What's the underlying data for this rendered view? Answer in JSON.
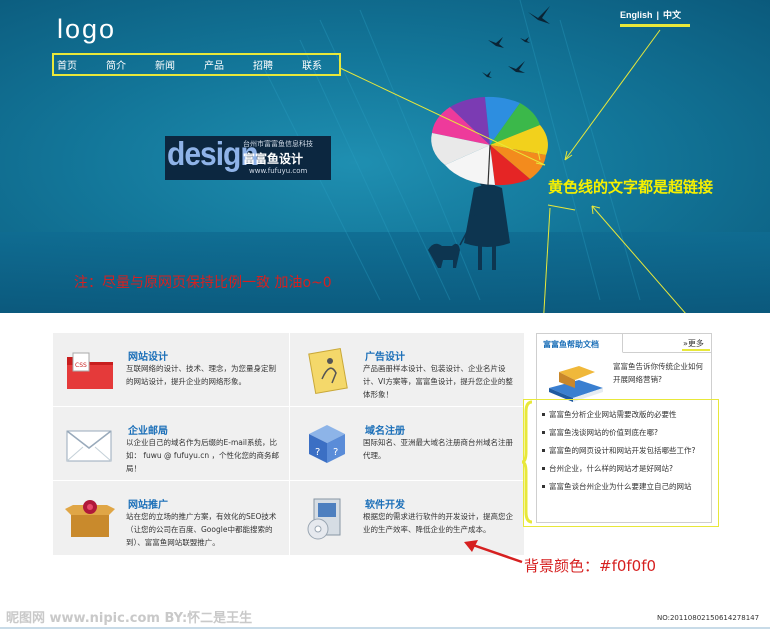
{
  "header": {
    "logo": "logo",
    "nav": [
      "首页",
      "简介",
      "新闻",
      "产品",
      "招聘",
      "联系"
    ],
    "lang_en": "English",
    "lang_sep": "|",
    "lang_cn": "中文"
  },
  "design_badge": {
    "word": "design",
    "company": "台州市富富鱼信息科技",
    "name": "富富鱼设计",
    "url": "www.fufuyu.com"
  },
  "annotations": {
    "hyperlink_note": "黄色线的文字都是超链接",
    "ratio_note": "注：尽量与原网页保持比例一致 加油o~0",
    "bg_note": "背景颜色：#f0f0f0"
  },
  "services": [
    {
      "title": "网站设计",
      "desc": "互联网络的设计、技术、理念，为您量身定制的网站设计，提升企业的网络形象。",
      "icon": "folder-css-icon"
    },
    {
      "title": "广告设计",
      "desc": "产品画册样本设计、包装设计、企业名片设计、VI方案等，富富鱼设计，提升您企业的整体形象！",
      "icon": "notepad-sketch-icon"
    },
    {
      "title": "企业邮局",
      "desc": "以企业自己的域名作为后缀的E-mail系统，比如： fuwu @ fufuyu.cn ，个性化您的商务邮局！",
      "icon": "envelope-icon"
    },
    {
      "title": "域名注册",
      "desc": "国际知名、亚洲最大域名注册商台州域名注册代理。",
      "icon": "cube-question-icon"
    },
    {
      "title": "网站推广",
      "desc": "站在您的立场的推广方案，有效化的SEO技术（让您的公司在百度、Google中都能搜索的到）、富富鱼网站联盟推广。",
      "icon": "gift-box-icon"
    },
    {
      "title": "软件开发",
      "desc": "根据您的需求进行软件的开发设计，提高您企业的生产效率、降低企业的生产成本。",
      "icon": "software-box-icon"
    }
  ],
  "help": {
    "tab": "富富鱼帮助文档",
    "more": "更多",
    "intro": "富富鱼告诉你传统企业如何开展网络营销?",
    "items": [
      "富富鱼分析企业网站需要改版的必要性",
      "富富鱼浅谈网站的价值到底在哪?",
      "富富鱼的网页设计和网站开发包括哪些工作?",
      "台州企业，什么样的网站才是好网站?",
      "富富鱼谈台州企业为什么要建立自己的网站"
    ]
  },
  "footer": {
    "watermark": "昵图网 www.nipic.com  BY:怀二是王生",
    "serial": "NO:20110802150614278147"
  },
  "colors": {
    "banner": "#13779a",
    "highlight": "#e8e83a",
    "link_blue": "#1b6fb8",
    "content_bg": "#f0f0f0",
    "note_red": "#d62020"
  }
}
